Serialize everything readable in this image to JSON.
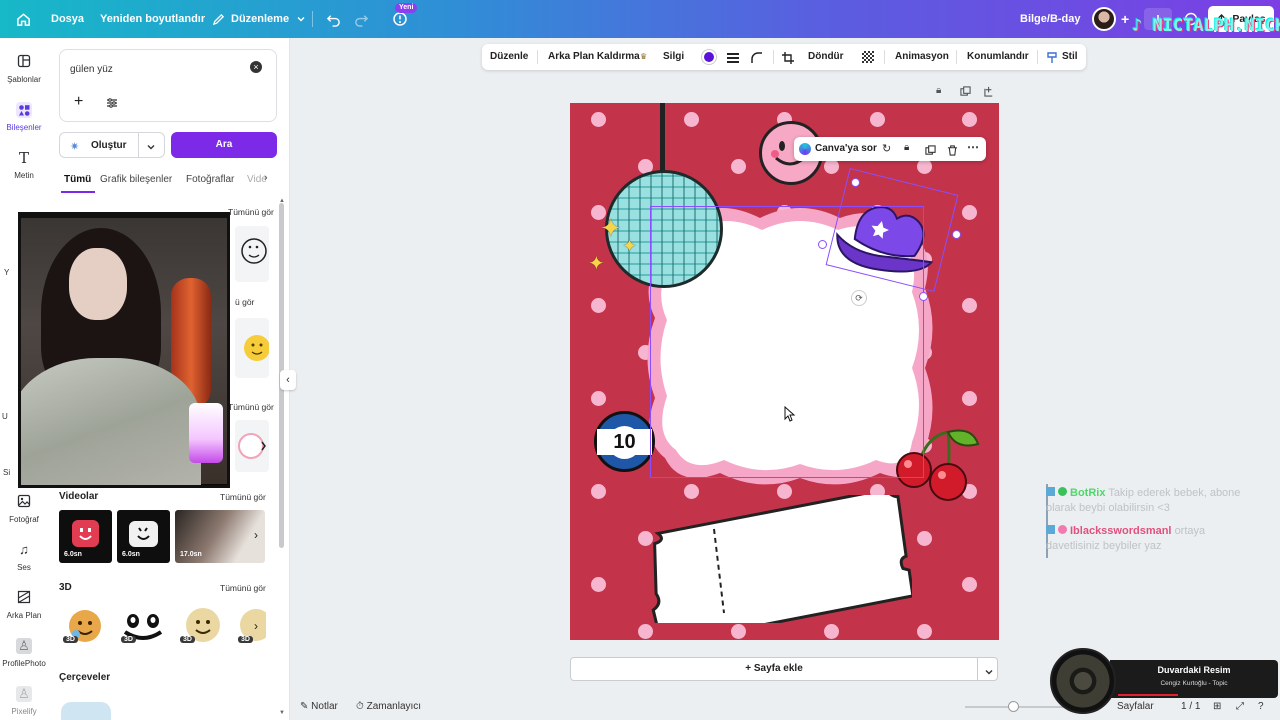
{
  "topbar": {
    "home_icon": "home-icon",
    "file": "Dosya",
    "resize": "Yeniden boyutlandır",
    "edit": "Düzenleme",
    "new_badge": "Yeni",
    "doc_title": "Bilge/B-day",
    "share": "Paylaş",
    "tiktok_watermark": "NICTALPH.NICK"
  },
  "rail": {
    "items": [
      {
        "label": "Şablonlar",
        "icon": "template-icon"
      },
      {
        "label": "Bileşenler",
        "icon": "elements-icon"
      },
      {
        "label": "Metin",
        "icon": "text-icon"
      },
      {
        "label": "Fotoğraf",
        "icon": "photo-icon"
      },
      {
        "label": "Ses",
        "icon": "audio-icon"
      },
      {
        "label": "Arka Plan",
        "icon": "background-icon"
      },
      {
        "label": "ProfilePhoto",
        "icon": "profile-photo-icon"
      },
      {
        "label": "Pixelify",
        "icon": "pixelify-icon"
      }
    ],
    "partial_labels": [
      "Y",
      "U",
      "Si"
    ]
  },
  "panel": {
    "search_value": "gülen yüz",
    "create_button": "Oluştur",
    "search_button": "Ara",
    "tabs": [
      "Tümü",
      "Grafik bileşenler",
      "Fotoğraflar",
      "Vide"
    ],
    "see_all": "Tümünü gör",
    "see_all_partial": "ü gör",
    "sections": {
      "videos": "Videolar",
      "three_d": "3D",
      "frames": "Çerçeveler"
    },
    "video_durations": [
      "6.0sn",
      "6.0sn",
      "17.0sn"
    ],
    "badge_3d": "3D"
  },
  "toolbar": {
    "arrange": "Düzenle",
    "bg_remove": "Arka Plan Kaldırma",
    "erase": "Silgi",
    "color": "#5b12d8",
    "rotate": "Döndür",
    "animate": "Animasyon",
    "position": "Konumlandır",
    "style": "Stil"
  },
  "element_menu": {
    "ask_canva": "Canva'ya sor"
  },
  "canvas": {
    "bg_color": "#c3344a",
    "ball_number": "10"
  },
  "bottom": {
    "add_page": "+ Sayfa ekle",
    "notes": "Notlar",
    "timer": "Zamanlayıcı",
    "pages": "Sayfalar",
    "page_count": "1 / 1"
  },
  "chat": [
    {
      "user": "BotRix",
      "message": "Takip ederek bebek, abone olarak beybi olabilirsin <3"
    },
    {
      "user": "Iblacksswordsmanl",
      "message": "ortaya davetlisiniz beybiler yaz"
    }
  ],
  "music": {
    "title": "Duvardaki Resim",
    "artist": "Cengiz Kurtoğlu - Topic"
  }
}
